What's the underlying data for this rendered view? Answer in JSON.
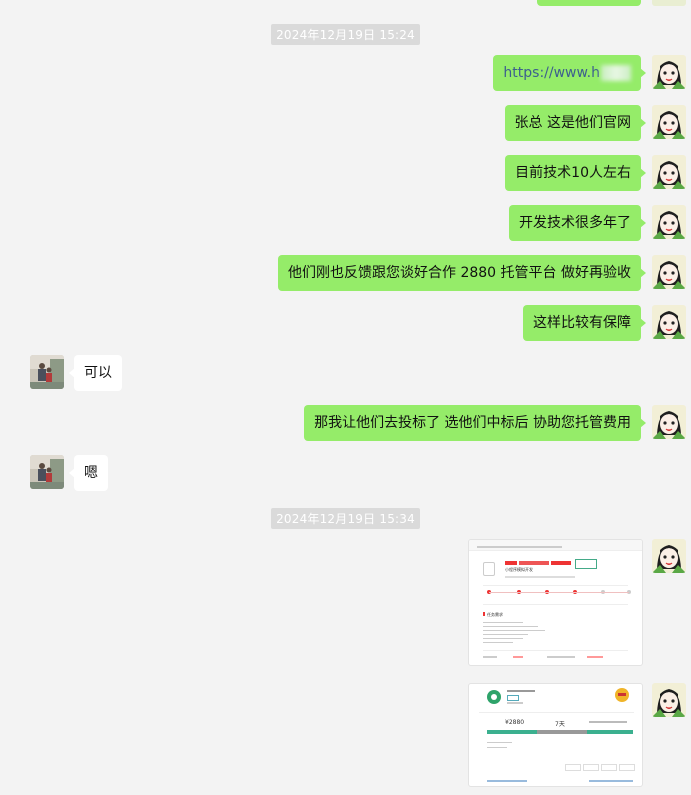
{
  "timestamps": [
    "2024年12月19日 15:24",
    "2024年12月19日 15:34"
  ],
  "messages": [
    {
      "side": "out",
      "text": "https://www.h"
    },
    {
      "side": "out",
      "text": "张总 这是他们官网"
    },
    {
      "side": "out",
      "text": "目前技术10人左右"
    },
    {
      "side": "out",
      "text": "开发技术很多年了"
    },
    {
      "side": "out",
      "text": "他们刚也反馈跟您谈好合作 2880 托管平台 做好再验收"
    },
    {
      "side": "out",
      "text": "这样比较有保障"
    },
    {
      "side": "in",
      "text": "可以"
    },
    {
      "side": "out",
      "text": "那我让他们去投标了 选他们中标后  协助您托管费用"
    },
    {
      "side": "in",
      "text": "嗯"
    }
  ],
  "image1": {
    "title": "小程序模拟开发",
    "section": "任务需求"
  },
  "image2": {
    "amount": "¥2880",
    "days": "7天"
  },
  "colors": {
    "outgoing_bubble": "#95ec69",
    "incoming_bubble": "#ffffff",
    "background": "#f3f3f3"
  }
}
